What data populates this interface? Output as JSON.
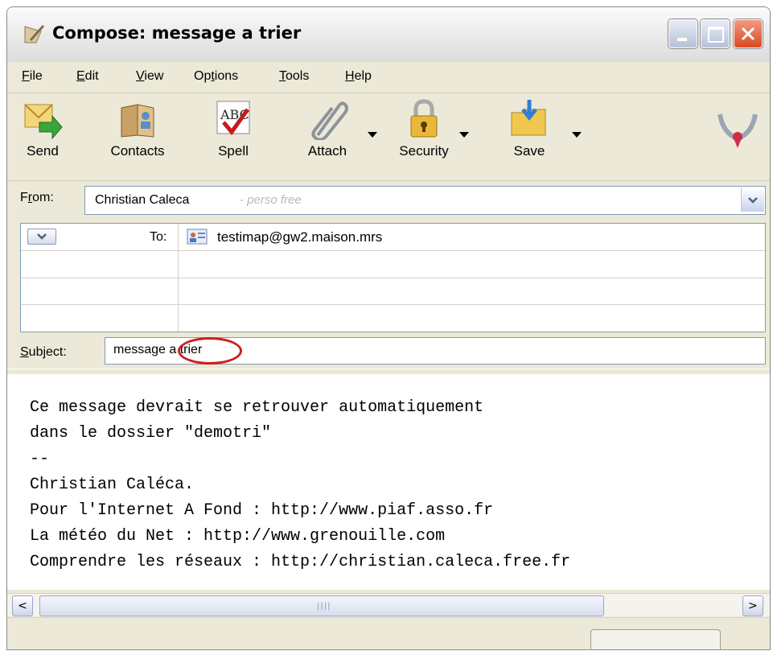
{
  "window": {
    "title": "Compose: message a trier"
  },
  "menu": [
    {
      "pre": "",
      "u": "F",
      "post": "ile"
    },
    {
      "pre": "",
      "u": "E",
      "post": "dit"
    },
    {
      "pre": "",
      "u": "V",
      "post": "iew"
    },
    {
      "pre": "Op",
      "u": "t",
      "post": "ions"
    },
    {
      "pre": "",
      "u": "T",
      "post": "ools"
    },
    {
      "pre": "",
      "u": "H",
      "post": "elp"
    }
  ],
  "toolbar": {
    "send": "Send",
    "contacts": "Contacts",
    "spell": "Spell",
    "attach": "Attach",
    "security": "Security",
    "save": "Save"
  },
  "from": {
    "label_pre": "F",
    "label_u": "r",
    "label_post": "om:",
    "name": "Christian Caleca",
    "account": "- perso free"
  },
  "recipients": {
    "type": "To:",
    "address": "testimap@gw2.maison.mrs"
  },
  "subject": {
    "label_u": "S",
    "label_post": "ubject:",
    "value": "message a trier"
  },
  "body": {
    "lines": [
      "Ce message devrait se retrouver automatiquement",
      "dans le dossier \"demotri\"",
      "--",
      "Christian Caléca.",
      "Pour l'Internet A Fond : http://www.piaf.asso.fr",
      "La météo du Net : http://www.grenouille.com",
      "Comprendre les réseaux : http://christian.caleca.free.fr"
    ]
  },
  "scrollbar": {
    "left": "<",
    "right": ">",
    "grip": "||||"
  },
  "colors": {
    "highlight_ring": "#cc1f1f",
    "close_button": "#d8491f"
  },
  "icons": [
    "compose-icon",
    "send-icon",
    "contacts-icon",
    "spell-icon",
    "attach-icon",
    "security-icon",
    "save-icon",
    "throbber-icon",
    "address-card-icon"
  ]
}
